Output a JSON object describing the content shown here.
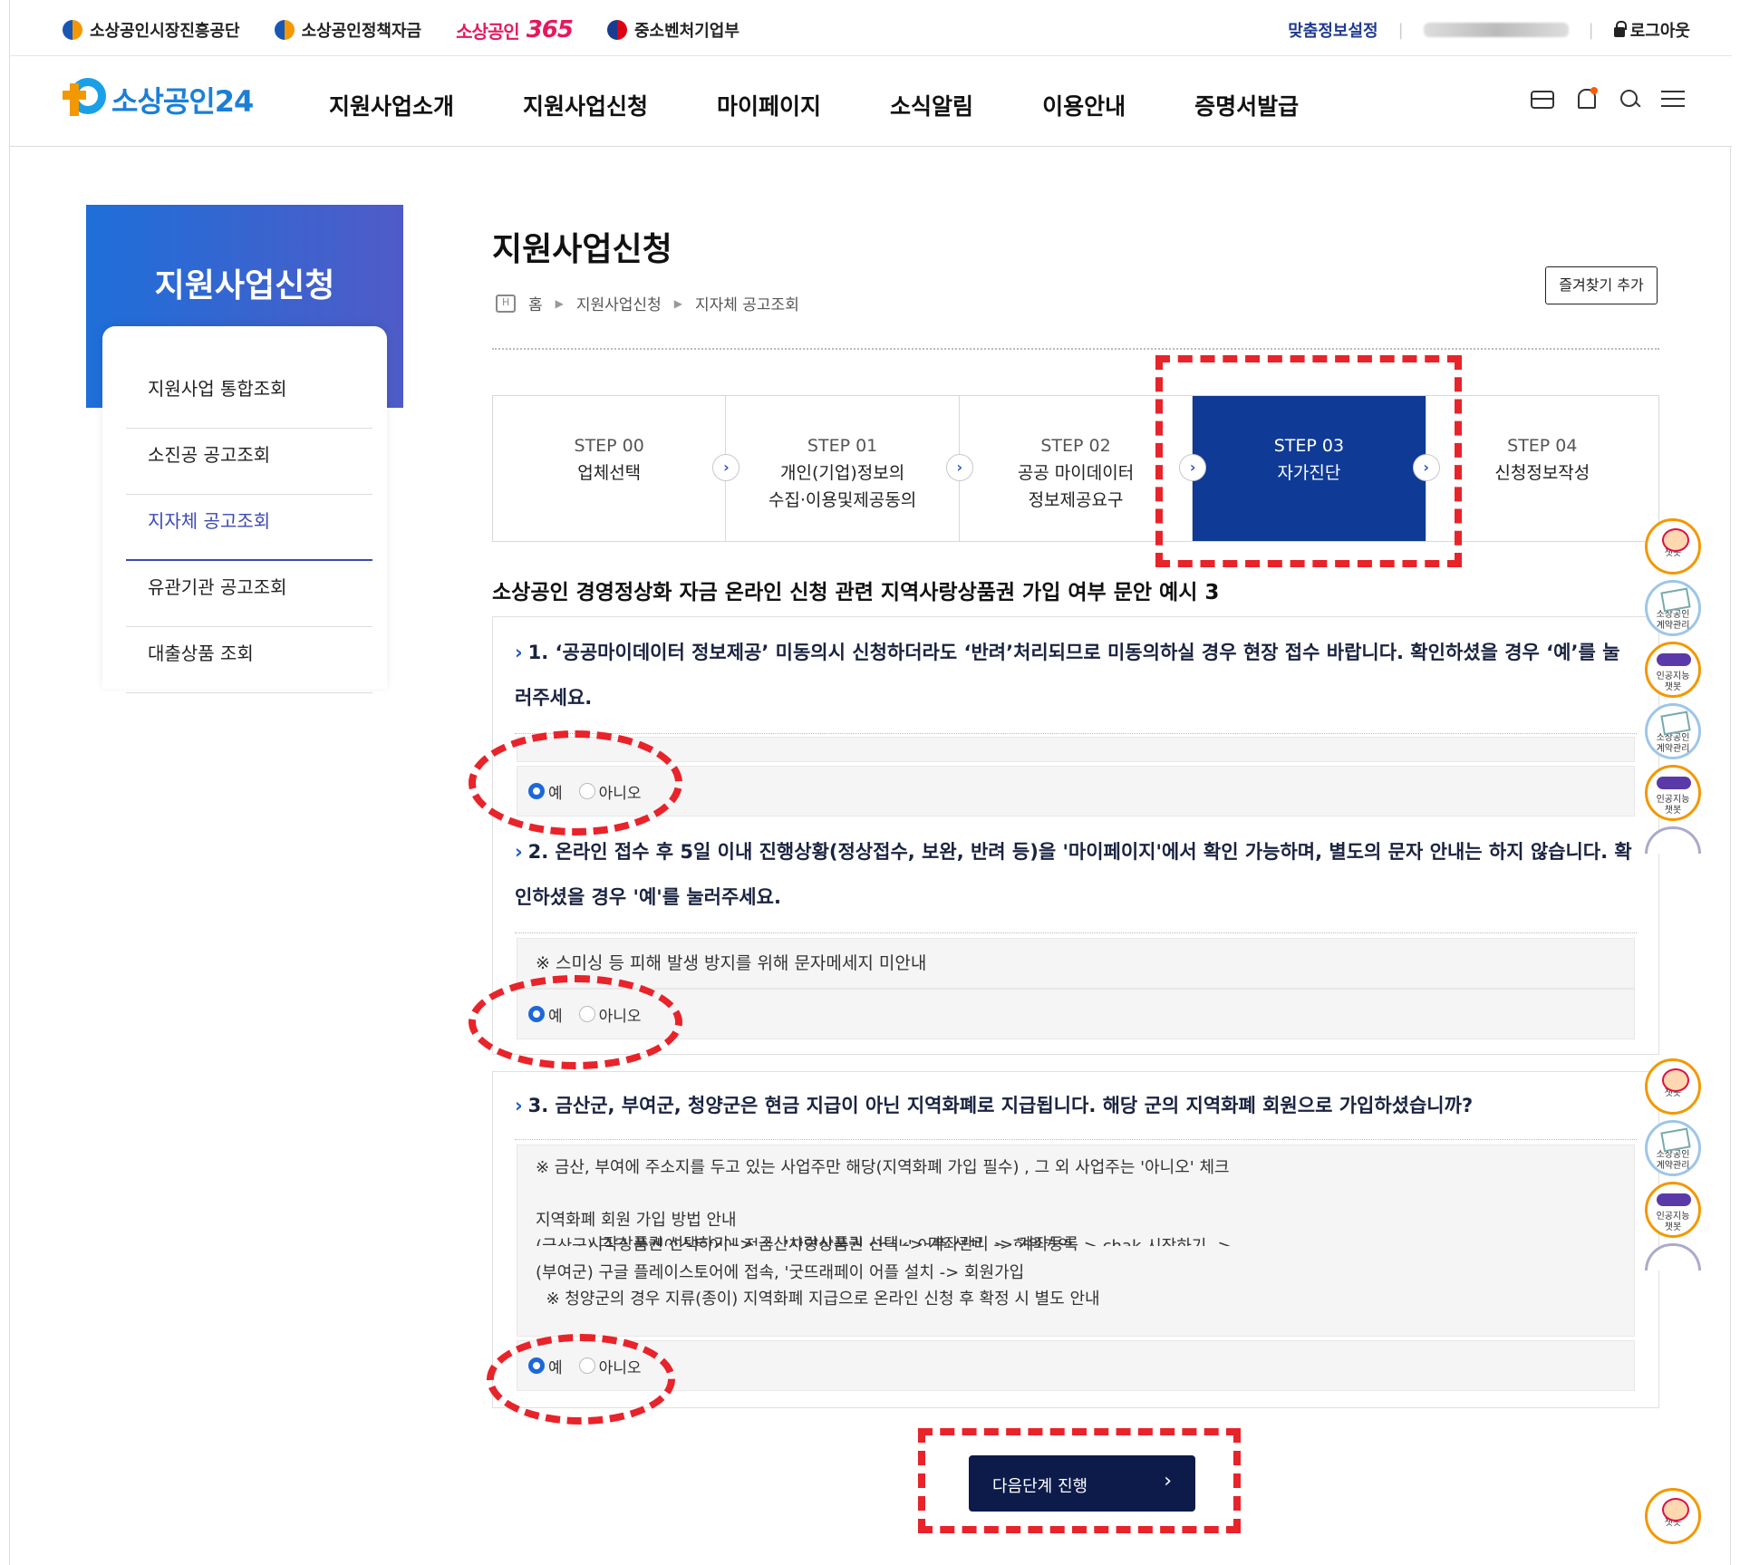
{
  "topbar": {
    "links": [
      "소상공인시장진흥공단",
      "소상공인정책자금",
      "소상공인",
      "365",
      "중소벤처기업부"
    ],
    "custom_info": "맞춤정보설정",
    "logout": "로그아웃"
  },
  "nav": {
    "logo": "소상공인24",
    "menu": [
      "지원사업소개",
      "지원사업신청",
      "마이페이지",
      "소식알림",
      "이용안내",
      "증명서발급"
    ]
  },
  "sidebar": {
    "title": "지원사업신청",
    "items": [
      "지원사업 통합조회",
      "소진공 공고조회",
      "지자체 공고조회",
      "유관기관 공고조회",
      "대출상품 조회"
    ]
  },
  "page": {
    "title": "지원사업신청",
    "breadcrumb": [
      "홈",
      "지원사업신청",
      "지자체 공고조회"
    ],
    "favorite_button": "즐겨찾기 추가"
  },
  "steps": [
    {
      "no": "STEP 00",
      "label1": "업체선택",
      "label2": ""
    },
    {
      "no": "STEP 01",
      "label1": "개인(기업)정보의",
      "label2": "수집·이용및제공동의"
    },
    {
      "no": "STEP 02",
      "label1": "공공 마이데이터",
      "label2": "정보제공요구"
    },
    {
      "no": "STEP 03",
      "label1": "자가진단",
      "label2": ""
    },
    {
      "no": "STEP 04",
      "label1": "신청정보작성",
      "label2": ""
    }
  ],
  "form_title": "소상공인 경영정상화 자금 온라인 신청 관련 지역사랑상품권 가입 여부 문안 예시 3",
  "questions": [
    {
      "line1": "1. ‘공공마이데이터 정보제공’ 미동의시 신청하더라도 ‘반려’처리되므로 미동의하실 경우 현장 접수 바랍니다. 확인하셨을 경우 ‘예’를 눌",
      "line2": "러주세요.",
      "yes": "예",
      "no": "아니오"
    },
    {
      "line1": "2. 온라인 접수 후 5일 이내 진행상황(정상접수, 보완, 반려 등)을 '마이페이지'에서 확인 가능하며, 별도의 문자 안내는 하지 않습니다. 확",
      "line2": "인하셨을 경우 '예'를 눌러주세요.",
      "note": "※ 스미싱 등 피해 발생 방지를 위해 문자메세지 미안내",
      "yes": "예",
      "no": "아니오"
    },
    {
      "line1": "3. 금산군, 부여군, 청양군은 현금 지급이 아닌 지역화폐로 지급됩니다. 해당 군의 지역화폐 회원으로 가입하셨습니까?",
      "note_lines": [
        "※ 금산, 부여에 주소지를 두고 있는 사업주만 해당(지역화폐 가입 필수) , 그 외 사업주는 '아니오' 체크",
        "",
        "지역화폐 회원 가입 방법 안내",
        "(금산군) 구글 플레이스토어에 접속, '지역상품권 chak' 어플 설치 -> 회원가입 -> chak 시작하기 ->",
        "시작상품권 선택하기 -> 금산사랑상품권 선택 -> 계좌관리 -> 계좌등록",
        "(부여군) 구글 플레이스토어에 접속, '굿뜨래페이  어플 설치 -> 회원가입",
        "  ※ 청양군의 경우 지류(종이) 지역화폐 지급으로 온라인 신청 후 확정 시 별도 안내"
      ],
      "yes": "예",
      "no": "아니오"
    }
  ],
  "next_button": "다음단계 진행",
  "floats": {
    "chatbot": "챗봇",
    "contract": "소상공인\n계약관리",
    "ai": "인공지능\n챗봇"
  }
}
